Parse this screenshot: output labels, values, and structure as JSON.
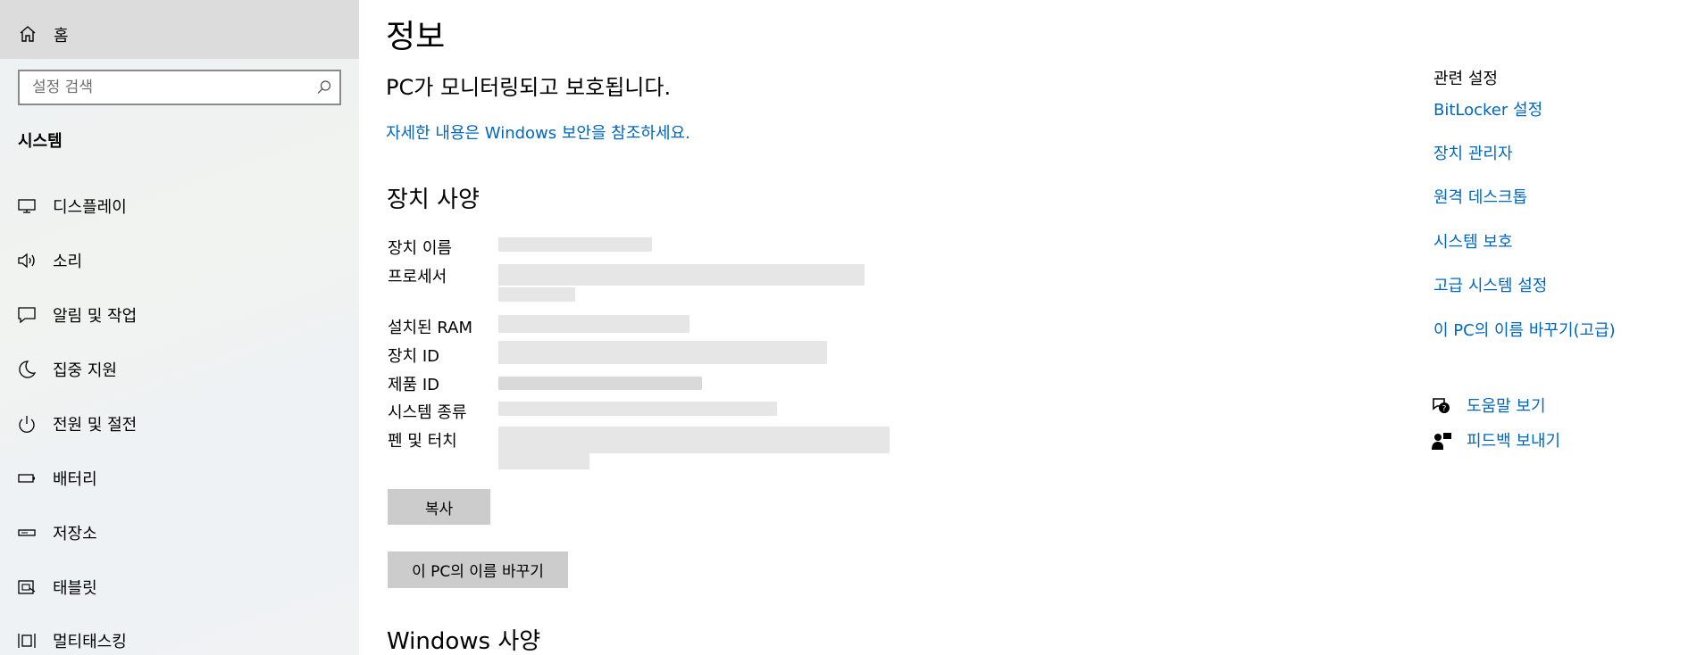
{
  "sidebar": {
    "home_label": "홈",
    "search_placeholder": "설정 검색",
    "section_title": "시스템",
    "items": [
      {
        "label": "디스플레이",
        "icon": "display-icon"
      },
      {
        "label": "소리",
        "icon": "sound-icon"
      },
      {
        "label": "알림 및 작업",
        "icon": "notification-icon"
      },
      {
        "label": "집중 지원",
        "icon": "focus-assist-icon"
      },
      {
        "label": "전원 및 절전",
        "icon": "power-icon"
      },
      {
        "label": "배터리",
        "icon": "battery-icon"
      },
      {
        "label": "저장소",
        "icon": "storage-icon"
      },
      {
        "label": "태블릿",
        "icon": "tablet-icon"
      },
      {
        "label": "멀티태스킹",
        "icon": "multitasking-icon"
      }
    ]
  },
  "main": {
    "title": "정보",
    "protected_message": "PC가 모니터링되고 보호됩니다.",
    "security_link": "자세한 내용은 Windows 보안을 참조하세요.",
    "device_specs_heading": "장치 사양",
    "spec_labels": [
      "장치 이름",
      "프로세서",
      "설치된 RAM",
      "장치 ID",
      "제품 ID",
      "시스템 종류",
      "펜 및 터치"
    ],
    "copy_button": "복사",
    "rename_button": "이 PC의 이름 바꾸기",
    "windows_specs_heading": "Windows 사양"
  },
  "related": {
    "title": "관련 설정",
    "links": [
      "BitLocker 설정",
      "장치 관리자",
      "원격 데스크톱",
      "시스템 보호",
      "고급 시스템 설정",
      "이 PC의 이름 바꾸기(고급)"
    ],
    "help_label": "도움말 보기",
    "feedback_label": "피드백 보내기"
  },
  "colors": {
    "link": "#0067c0",
    "button_bg": "#cccccc",
    "home_highlight": "#dcdcdc"
  }
}
